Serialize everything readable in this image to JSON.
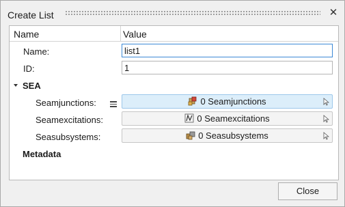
{
  "dialog": {
    "title": "Create List",
    "close_icon": "close-icon"
  },
  "table": {
    "col_name": "Name",
    "col_value": "Value"
  },
  "fields": {
    "name_label": "Name:",
    "name_value": "list1",
    "id_label": "ID:",
    "id_value": "1"
  },
  "sea": {
    "section_label": "SEA",
    "junctions_label": "Seamjunctions:",
    "junctions_value": "0 Seamjunctions",
    "junctions_icon": "seamjunction-icon",
    "excitations_label": "Seamexcitations:",
    "excitations_value": "0 Seamexcitations",
    "excitations_icon": "seamexcitation-icon",
    "subsystems_label": "Seasubsystems:",
    "subsystems_value": "0 Seasubsystems",
    "subsystems_icon": "seasubsystem-icon"
  },
  "metadata": {
    "section_label": "Metadata"
  },
  "footer": {
    "close_label": "Close"
  },
  "colors": {
    "active_selector": "#dceefa",
    "focus_border": "#3a88d6"
  }
}
